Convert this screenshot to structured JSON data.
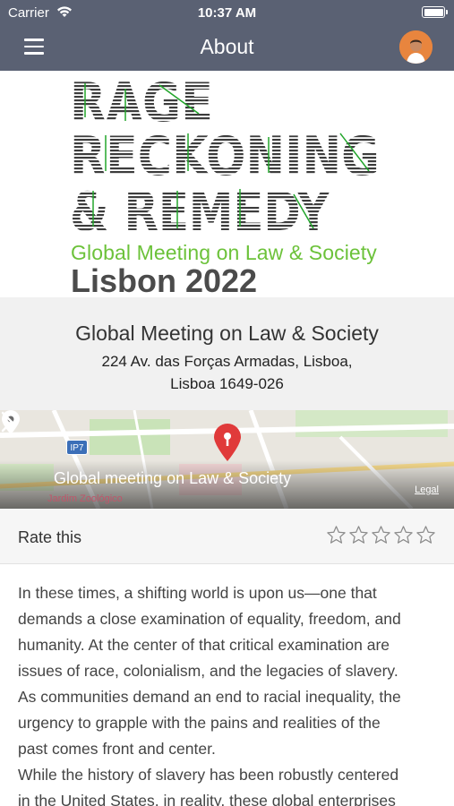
{
  "status_bar": {
    "carrier": "Carrier",
    "time": "10:37 AM"
  },
  "nav": {
    "title": "About",
    "menu_icon": "hamburger-menu-icon",
    "avatar_icon": "user-avatar"
  },
  "banner": {
    "line1": "RAGE",
    "line2": "RECKONING",
    "line3": "& REMEDY",
    "subtitle": "Global Meeting on Law & Society",
    "city": "Lisbon 2022"
  },
  "event": {
    "title": "Global Meeting on Law & Society",
    "address_line1": "224 Av. das Forças Armadas, Lisboa,",
    "address_line2": "Lisboa 1649-026"
  },
  "map": {
    "location_label": "Global meeting on Law & Society",
    "poi": "Jardim Zoológico",
    "road_badge": "IP7",
    "legal": "Legal"
  },
  "rating": {
    "label": "Rate this",
    "max": 5,
    "value": 0
  },
  "description": {
    "lines": [
      "In these times, a shifting world is upon us—one that",
      "demands a close examination of equality, freedom, and",
      "humanity. At the center of that critical examination are",
      "issues of race, colonialism, and the legacies of slavery.",
      "As communities demand an end to racial inequality, the",
      "urgency to grapple with the pains and realities of the",
      "past comes front and center.",
      "While the history of slavery has been robustly centered",
      "in the United States, in reality, these global enterprises"
    ]
  },
  "colors": {
    "header": "#5a6173",
    "banner_green": "#6cc23a",
    "map_pin": "#e03a3a"
  }
}
